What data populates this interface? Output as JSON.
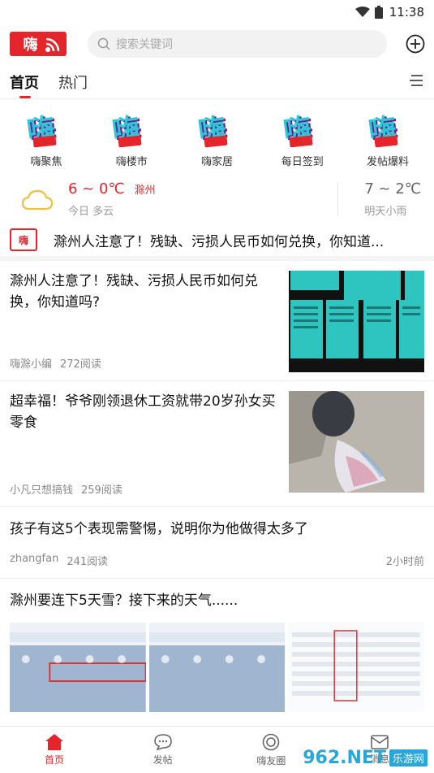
{
  "status": {
    "time": "11:38"
  },
  "header": {
    "logo_text": "嗨",
    "search_placeholder": "搜索关键词"
  },
  "tabs": [
    {
      "label": "首页"
    },
    {
      "label": "热门"
    }
  ],
  "quick_links": [
    {
      "label": "嗨聚焦"
    },
    {
      "label": "嗨楼市"
    },
    {
      "label": "嗨家居"
    },
    {
      "label": "每日签到"
    },
    {
      "label": "发帖爆料"
    }
  ],
  "weather": {
    "today_temp": "6 ~ 0℃",
    "city": "滁州",
    "today_desc": "今日 多云",
    "tomorrow_temp": "7 ~ 2℃",
    "tomorrow_desc": "明天小雨"
  },
  "ticker": {
    "icon_text": "嗨",
    "text": "滁州人注意了！残缺、污损人民币如何兑换，你知道..."
  },
  "articles": [
    {
      "title": "滁州人注意了！残缺、污损人民币如何兑换，你知道吗?",
      "author": "嗨滁小编",
      "reads": "272阅读"
    },
    {
      "title": "超幸福！爷爷刚领退休工资就带20岁孙女买零食",
      "author": "小凡只想搞钱",
      "reads": "259阅读"
    },
    {
      "title": "孩子有这5个表现需警惕，说明你为他做得太多了",
      "author": "zhangfan",
      "reads": "241阅读",
      "time": "2小时前"
    },
    {
      "title": "滁州要连下5天雪？接下来的天气......"
    }
  ],
  "bottom_nav": [
    {
      "label": "首页"
    },
    {
      "label": "发帖"
    },
    {
      "label": "嗨友圈"
    },
    {
      "label": "消息"
    }
  ],
  "watermark": {
    "text": "962.NET",
    "sub": "乐游网"
  },
  "colors": {
    "accent": "#e4252b",
    "icon_cyan": "#2cc6d8"
  }
}
